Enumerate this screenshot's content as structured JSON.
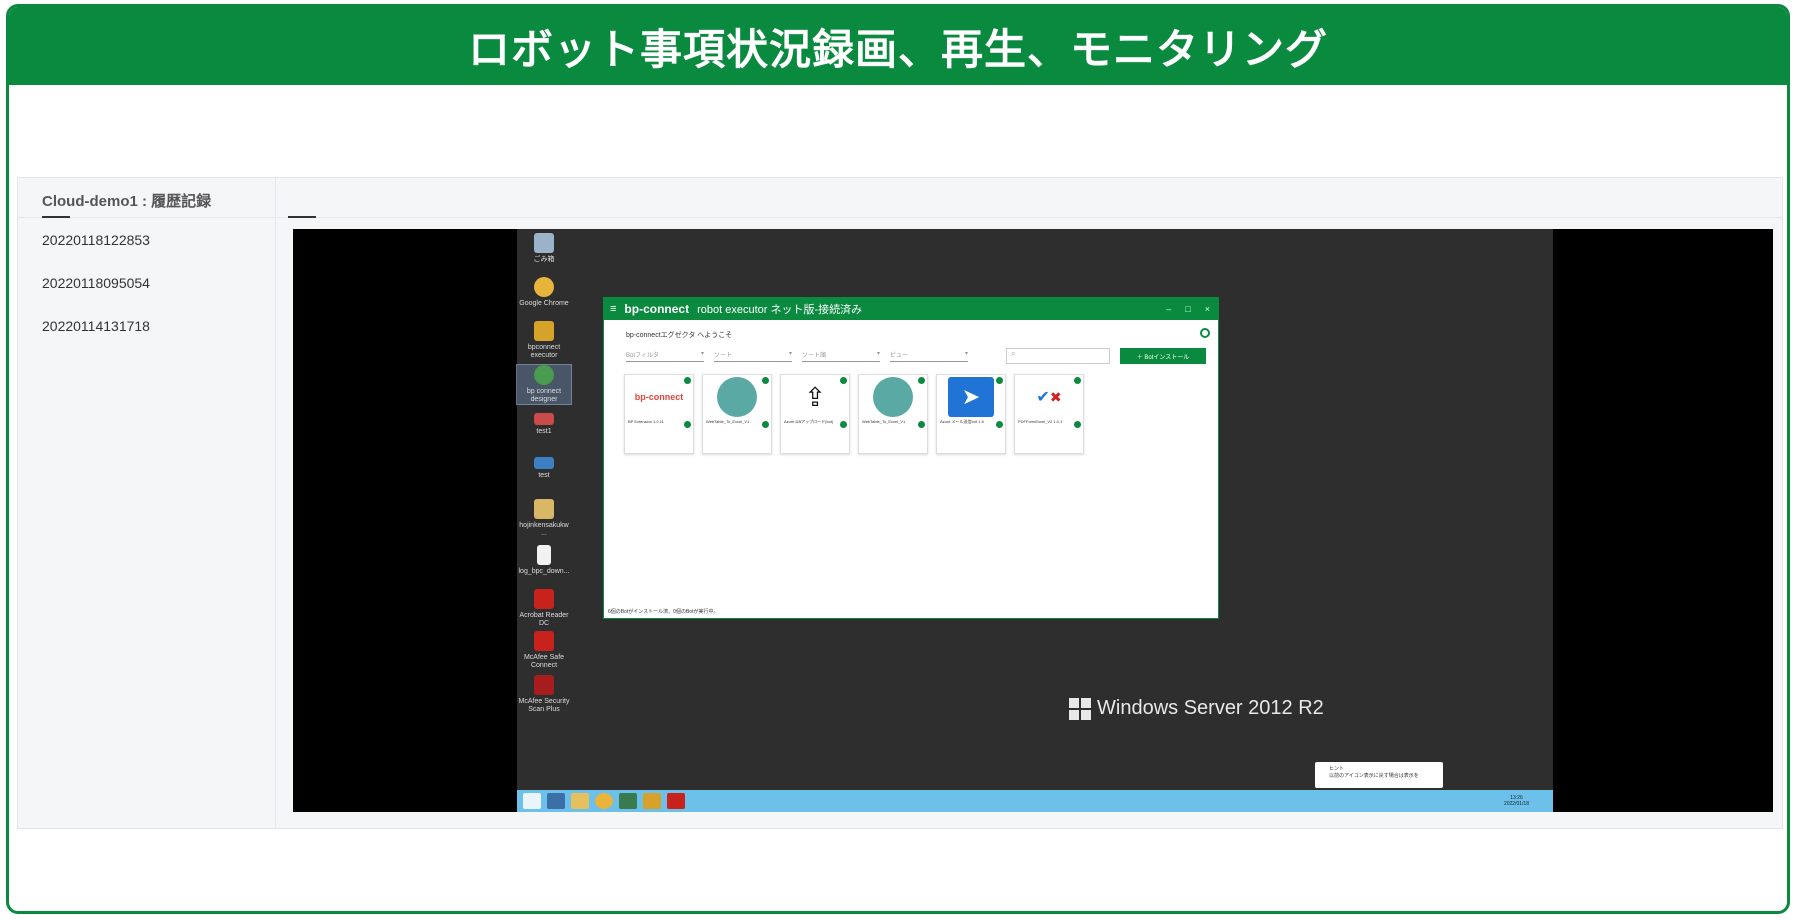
{
  "banner": {
    "title": "ロボット事項状況録画、再生、モニタリング"
  },
  "history": {
    "header": "Cloud-demo1 : 履歴記録",
    "records": [
      "20220118122853",
      "20220118095054",
      "20220114131718"
    ]
  },
  "desktop": {
    "icons": [
      {
        "label": "ごみ箱",
        "icon": "recycle-bin-icon",
        "color": "#9bb3c8"
      },
      {
        "label": "Google Chrome",
        "icon": "chrome-icon",
        "color": "#e8b53a"
      },
      {
        "label": "bpconnect executor",
        "icon": "bp-executor-icon",
        "color": "#d7a22a"
      },
      {
        "label": "bp connect designer",
        "icon": "bp-designer-icon",
        "color": "#4a9a4f"
      },
      {
        "label": "test1",
        "icon": "folder-red-icon",
        "color": "#c94b4b"
      },
      {
        "label": "test",
        "icon": "folder-blue-icon",
        "color": "#3d7fc4"
      },
      {
        "label": "hojinkensakukw ...",
        "icon": "zip-folder-icon",
        "color": "#d9b766"
      },
      {
        "label": "log_bpc_down...",
        "icon": "document-icon",
        "color": "#f2f2f2"
      },
      {
        "label": "Acrobat Reader DC",
        "icon": "acrobat-icon",
        "color": "#c8221c"
      },
      {
        "label": "McAfee Safe Connect",
        "icon": "mcafee-connect-icon",
        "color": "#c8221c"
      },
      {
        "label": "McAfee Security Scan Plus",
        "icon": "mcafee-scan-icon",
        "color": "#a71c1c"
      }
    ],
    "os_label": "Windows Server 2012 R2",
    "toast": {
      "title": "ヒント",
      "text": "以前のアイコン表示に戻す場合は表示を"
    },
    "clock": {
      "time": "13:26",
      "date": "2022/01/18"
    }
  },
  "app": {
    "brand": "bp-connect",
    "title": "robot executor ネット版-接続済み",
    "welcome": "bp-connectエグゼクタ へようこそ",
    "filters": [
      "Botフィルタ",
      "ソート",
      "ソート順",
      "ビュー"
    ],
    "install_label": "＋ Botインストール",
    "cards": [
      {
        "name": "BP Extension 1.0.11",
        "art": "bp-connect-logo"
      },
      {
        "name": "WebTable_To_Excel_V1",
        "art": "bp-bubble"
      },
      {
        "name": "Azure DBアップロード(bot)",
        "art": "upload-icon"
      },
      {
        "name": "WebTable_To_Excel_V1",
        "art": "bp-bubble"
      },
      {
        "name": "Azure メール送信bot 1.6",
        "art": "send-icon"
      },
      {
        "name": "PDFFormExcel_V2 1.0.1",
        "art": "checklist-icon"
      }
    ],
    "status": "6個のBotがインストール済、0個のBotが実行中。"
  },
  "colors": {
    "brand_green": "#0a8a3f",
    "taskbar_blue": "#6cc0ea",
    "desktop_bg": "#2e2e2e"
  }
}
